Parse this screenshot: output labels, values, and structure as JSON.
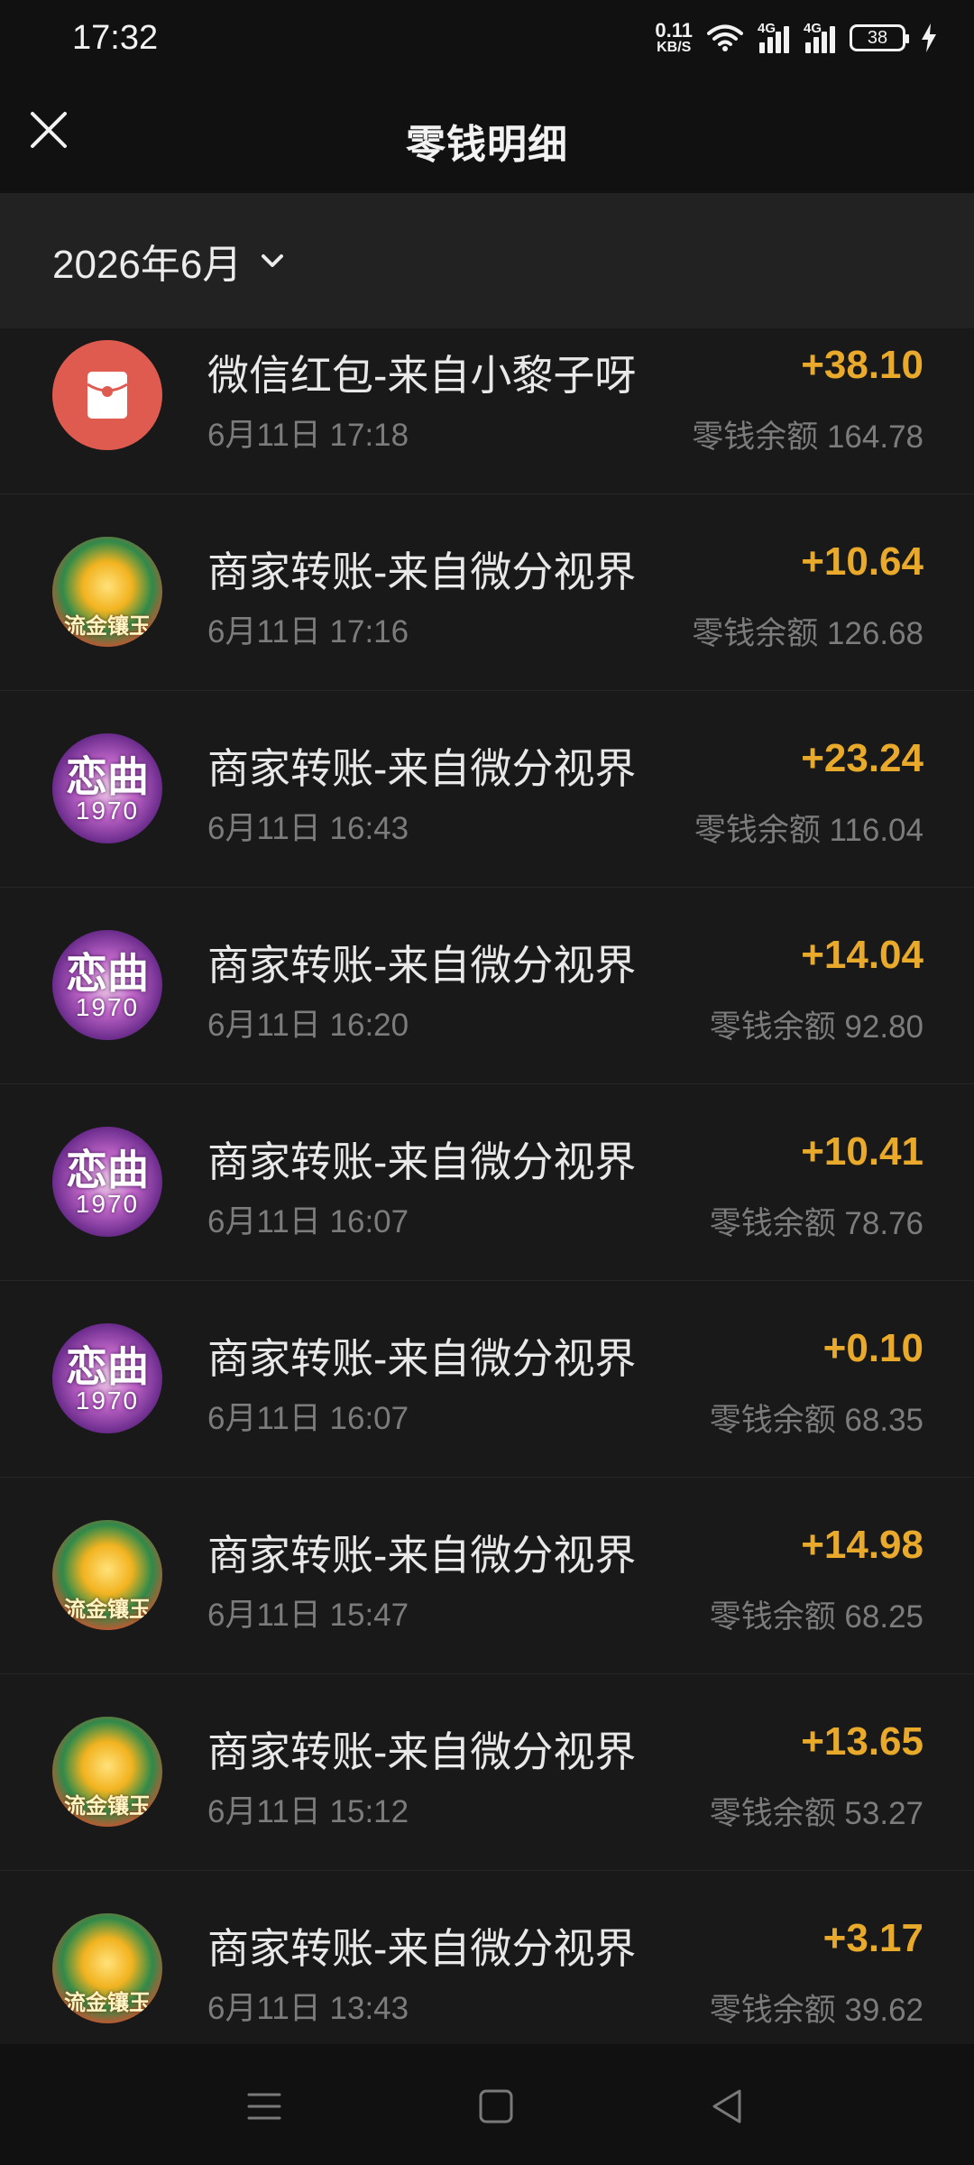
{
  "status_bar": {
    "time": "17:32",
    "net_speed_value": "0.11",
    "net_speed_unit": "KB/S",
    "sim1_tag": "4G",
    "sim2_tag": "4G",
    "battery": "38"
  },
  "header": {
    "title": "零钱明细",
    "close_icon": "close-icon"
  },
  "filter": {
    "month": "2026年6月",
    "dropdown_icon": "chevron-down-icon"
  },
  "transactions": [
    {
      "avatar": "red-packet",
      "title": "微信红包-来自小黎子呀",
      "time": "6月11日 17:18",
      "amount": "+38.10",
      "balance": "零钱余额 164.78"
    },
    {
      "avatar": "gold",
      "avatar_text": "流金镶玉",
      "title": "商家转账-来自微分视界",
      "time": "6月11日 17:16",
      "amount": "+10.64",
      "balance": "零钱余额 126.68"
    },
    {
      "avatar": "purple",
      "avatar_text": "恋曲",
      "avatar_sub": "1970",
      "title": "商家转账-来自微分视界",
      "time": "6月11日 16:43",
      "amount": "+23.24",
      "balance": "零钱余额 116.04"
    },
    {
      "avatar": "purple",
      "avatar_text": "恋曲",
      "avatar_sub": "1970",
      "title": "商家转账-来自微分视界",
      "time": "6月11日 16:20",
      "amount": "+14.04",
      "balance": "零钱余额 92.80"
    },
    {
      "avatar": "purple",
      "avatar_text": "恋曲",
      "avatar_sub": "1970",
      "title": "商家转账-来自微分视界",
      "time": "6月11日 16:07",
      "amount": "+10.41",
      "balance": "零钱余额 78.76"
    },
    {
      "avatar": "purple",
      "avatar_text": "恋曲",
      "avatar_sub": "1970",
      "title": "商家转账-来自微分视界",
      "time": "6月11日 16:07",
      "amount": "+0.10",
      "balance": "零钱余额 68.35"
    },
    {
      "avatar": "gold",
      "avatar_text": "流金镶玉",
      "title": "商家转账-来自微分视界",
      "time": "6月11日 15:47",
      "amount": "+14.98",
      "balance": "零钱余额 68.25"
    },
    {
      "avatar": "gold",
      "avatar_text": "流金镶玉",
      "title": "商家转账-来自微分视界",
      "time": "6月11日 15:12",
      "amount": "+13.65",
      "balance": "零钱余额 53.27"
    },
    {
      "avatar": "gold",
      "avatar_text": "流金镶玉",
      "title": "商家转账-来自微分视界",
      "time": "6月11日 13:43",
      "amount": "+3.17",
      "balance": "零钱余额 39.62"
    }
  ],
  "nav_bar": {
    "menu_icon": "menu-icon",
    "home_icon": "home-square-icon",
    "back_icon": "back-triangle-icon"
  },
  "colors": {
    "amount": "#e9a92a",
    "background": "#191919",
    "header": "#111111",
    "secondary_text": "#7c7c7c"
  }
}
